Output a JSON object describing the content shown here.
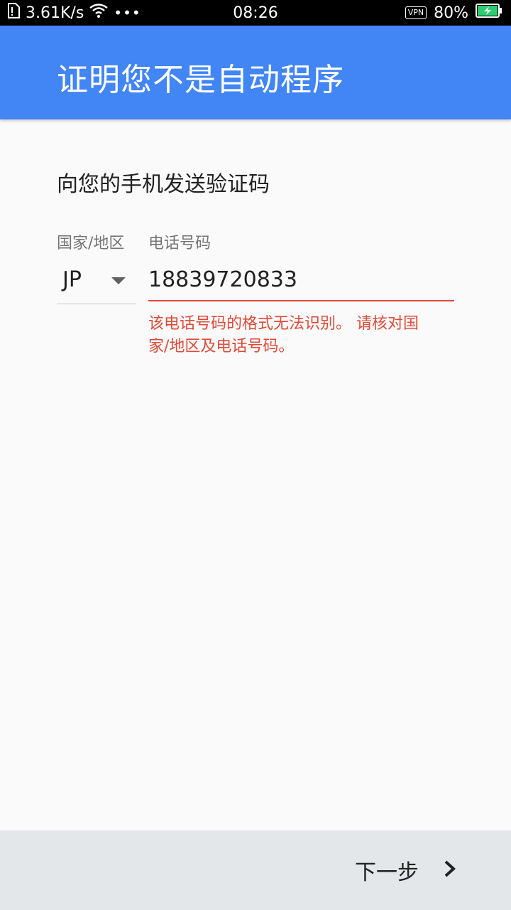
{
  "status_bar": {
    "speed": "3.61K/s",
    "time": "08:26",
    "vpn": "VPN",
    "battery": "80%"
  },
  "app_bar": {
    "title": "证明您不是自动程序"
  },
  "form": {
    "subtitle": "向您的手机发送验证码",
    "country_label": "国家/地区",
    "phone_label": "电话号码",
    "country_value": "JP",
    "phone_value": "18839720833",
    "error_message": "该电话号码的格式无法识别。 请核对国家/地区及电话号码。"
  },
  "footer": {
    "next_label": "下一步"
  },
  "icons": {
    "dropdown": "chevron-down-icon",
    "next": "chevron-right-icon",
    "wifi": "wifi-icon",
    "battery": "battery-charging-icon",
    "sim": "sim-icon"
  },
  "colors": {
    "app_bar": "#4285f4",
    "error": "#dd4b39",
    "bottom_bar": "#e3e7ea",
    "battery_fill": "#2ecc71"
  }
}
